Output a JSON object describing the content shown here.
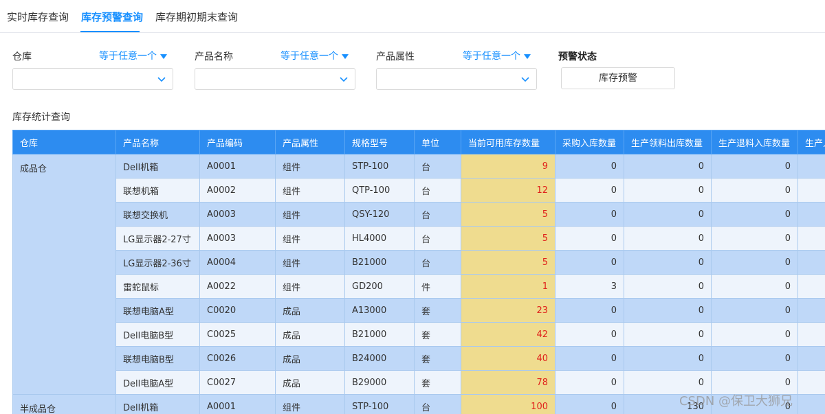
{
  "tabs": [
    {
      "label": "实时库存查询",
      "active": false
    },
    {
      "label": "库存预警查询",
      "active": true
    },
    {
      "label": "库存期初期末查询",
      "active": false
    }
  ],
  "filters": {
    "warehouse": {
      "label": "仓库",
      "operator": "等于任意一个",
      "value": ""
    },
    "product_name": {
      "label": "产品名称",
      "operator": "等于任意一个",
      "value": ""
    },
    "product_attr": {
      "label": "产品属性",
      "operator": "等于任意一个",
      "value": ""
    },
    "warn_status": {
      "label": "预警状态",
      "button": "库存预警"
    }
  },
  "section_title": "库存统计查询",
  "table": {
    "columns": [
      "仓库",
      "产品名称",
      "产品编码",
      "产品属性",
      "规格型号",
      "单位",
      "当前可用库存数量",
      "采购入库数量",
      "生产领料出库数量",
      "生产退料入库数量",
      "生产入"
    ],
    "groups": [
      {
        "warehouse": "成品仓",
        "rows": [
          [
            "Dell机箱",
            "A0001",
            "组件",
            "STP-100",
            "台",
            "9",
            "0",
            "0",
            "0"
          ],
          [
            "联想机箱",
            "A0002",
            "组件",
            "QTP-100",
            "台",
            "12",
            "0",
            "0",
            "0"
          ],
          [
            "联想交换机",
            "A0003",
            "组件",
            "QSY-120",
            "台",
            "5",
            "0",
            "0",
            "0"
          ],
          [
            "LG显示器2-27寸",
            "A0003",
            "组件",
            "HL4000",
            "台",
            "5",
            "0",
            "0",
            "0"
          ],
          [
            "LG显示器2-36寸",
            "A0004",
            "组件",
            "B21000",
            "台",
            "5",
            "0",
            "0",
            "0"
          ],
          [
            "雷蛇鼠标",
            "A0022",
            "组件",
            "GD200",
            "件",
            "1",
            "3",
            "0",
            "0"
          ],
          [
            "联想电脑A型",
            "C0020",
            "成品",
            "A13000",
            "套",
            "23",
            "0",
            "0",
            "0"
          ],
          [
            "Dell电脑B型",
            "C0025",
            "成品",
            "B21000",
            "套",
            "42",
            "0",
            "0",
            "0"
          ],
          [
            "联想电脑B型",
            "C0026",
            "成品",
            "B24000",
            "套",
            "40",
            "0",
            "0",
            "0"
          ],
          [
            "Dell电脑A型",
            "C0027",
            "成品",
            "B29000",
            "套",
            "78",
            "0",
            "0",
            "0"
          ]
        ]
      },
      {
        "warehouse": "半成品仓",
        "rows": [
          [
            "Dell机箱",
            "A0001",
            "组件",
            "STP-100",
            "台",
            "100",
            "0",
            "130",
            "0"
          ]
        ]
      }
    ]
  },
  "colors": {
    "accent": "#1890ff",
    "header_bg": "#2d8cf0",
    "qty_bg": "#efdc8f",
    "qty_text": "#e0211b"
  },
  "watermark": "CSDN @保卫大狮兄"
}
